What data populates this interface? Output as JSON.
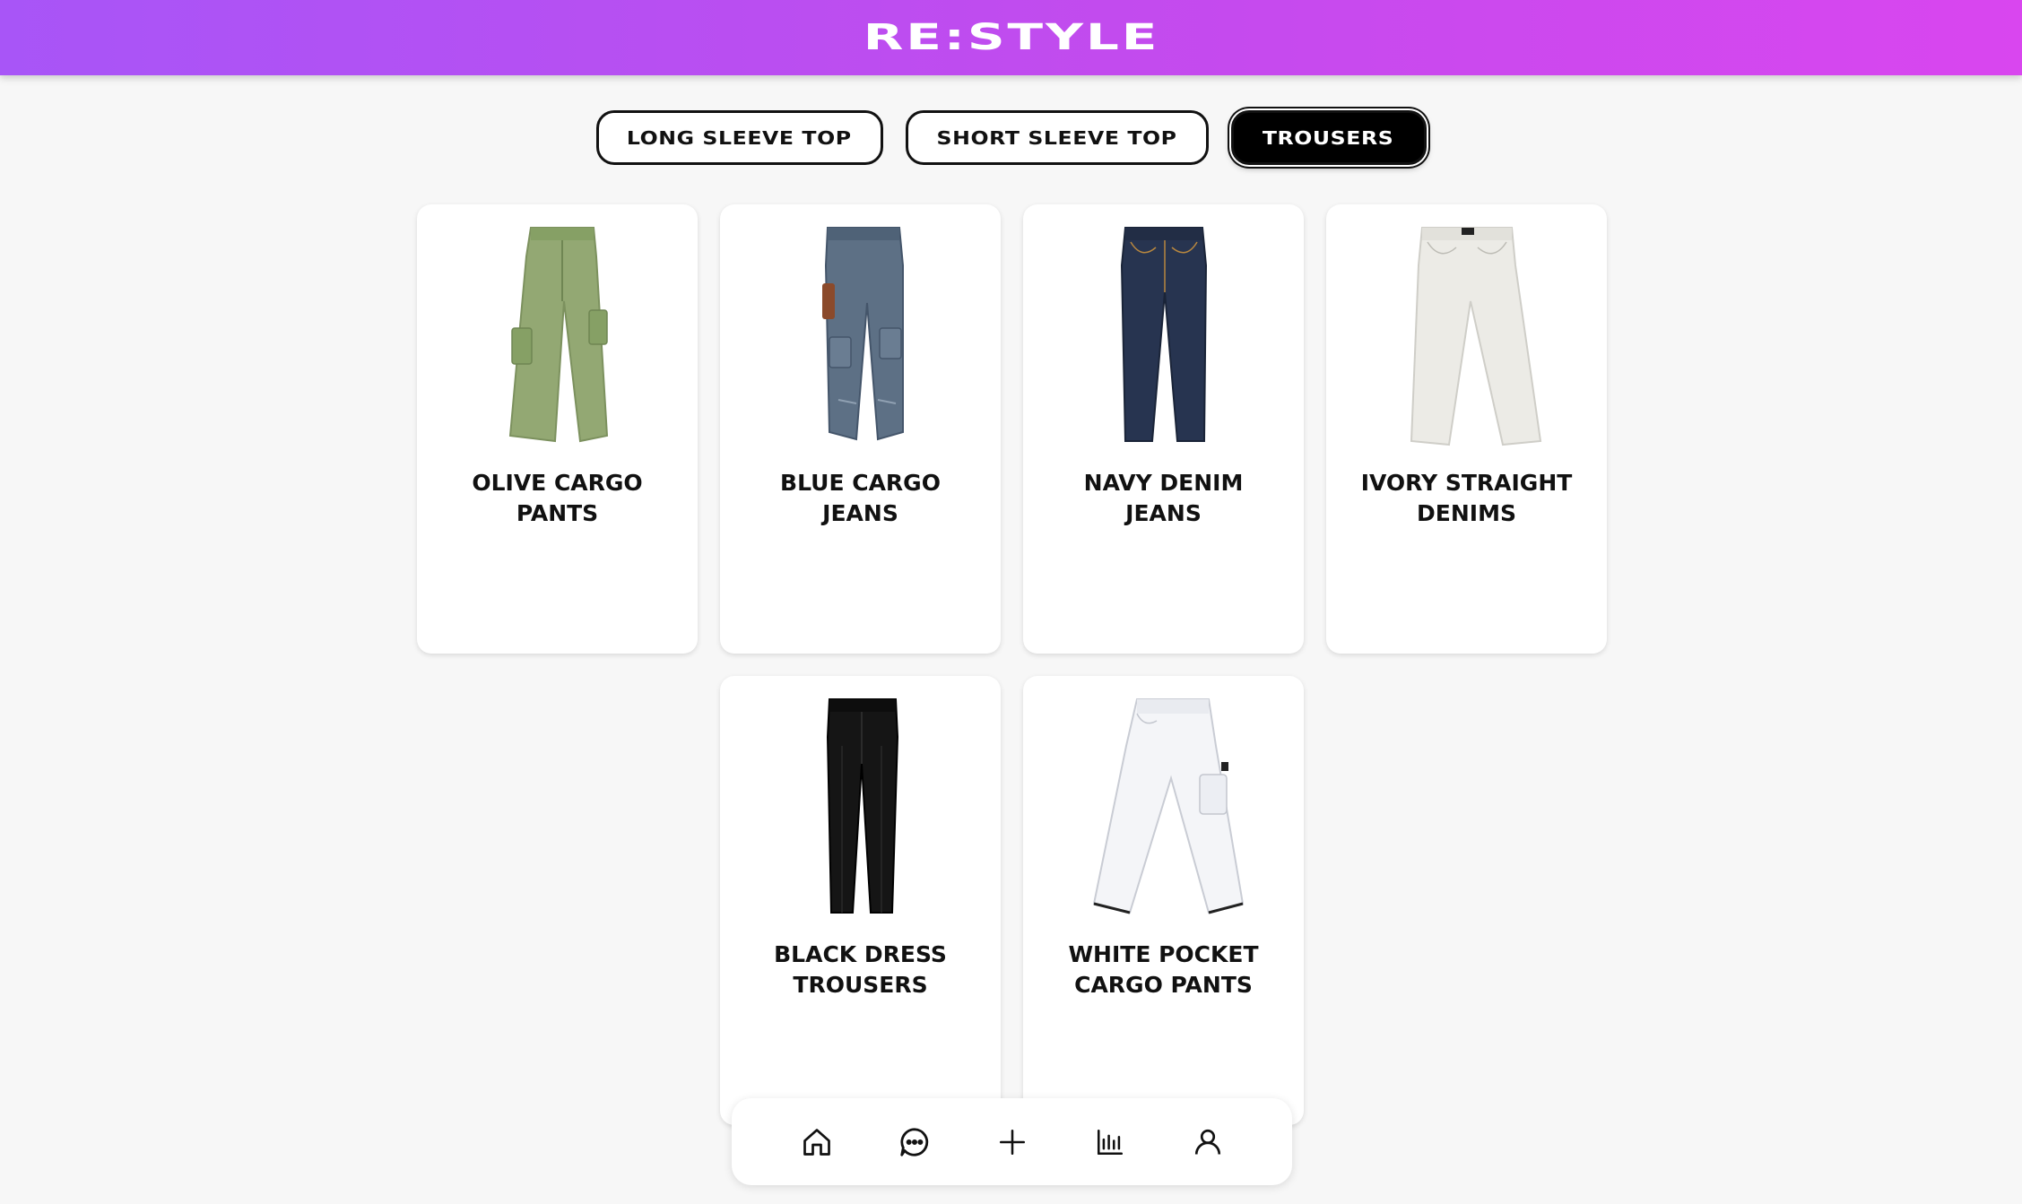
{
  "header": {
    "logo": "RE:STYLE",
    "gradient_start": "#a855f7",
    "gradient_end": "#d946ef"
  },
  "tabs": [
    {
      "label": "LONG SLEEVE TOP",
      "active": false
    },
    {
      "label": "SHORT SLEEVE TOP",
      "active": false
    },
    {
      "label": "TROUSERS",
      "active": true
    }
  ],
  "items": [
    {
      "name": "OLIVE CARGO PANTS",
      "color": "#93a873",
      "style": "cargo"
    },
    {
      "name": "BLUE CARGO JEANS",
      "color": "#5d7085",
      "style": "cargo-denim"
    },
    {
      "name": "NAVY DENIM JEANS",
      "color": "#273450",
      "style": "straight"
    },
    {
      "name": "IVORY STRAIGHT DENIMS",
      "color": "#ecebe6",
      "style": "straight"
    },
    {
      "name": "BLACK DRESS TROUSERS",
      "color": "#151515",
      "style": "dress"
    },
    {
      "name": "WHITE POCKET CARGO PANTS",
      "color": "#f4f5f8",
      "style": "cargo"
    }
  ],
  "nav": [
    {
      "icon": "home-icon"
    },
    {
      "icon": "chat-icon"
    },
    {
      "icon": "plus-icon"
    },
    {
      "icon": "chart-icon"
    },
    {
      "icon": "profile-icon"
    }
  ]
}
